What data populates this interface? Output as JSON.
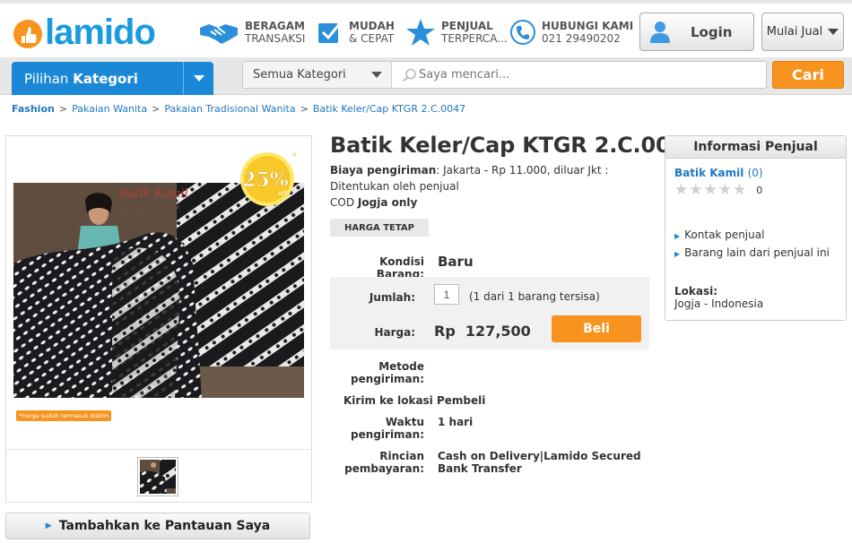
{
  "header": {
    "logo_text": "lamido",
    "features": [
      {
        "icon": "handshake-icon",
        "line1": "BERAGAM",
        "line2": "TRANSAKSI"
      },
      {
        "icon": "checkbox-icon",
        "line1": "MUDAH",
        "line2": "& CEPAT"
      },
      {
        "icon": "star-icon",
        "line1": "PENJUAL",
        "line2": "TERPERCA..."
      },
      {
        "icon": "phone-icon",
        "line1": "HUBUNGI KAMI",
        "line2": "021 29490202"
      }
    ],
    "login_label": "Login",
    "mulai_jual_label": "Mulai Jual"
  },
  "navbar": {
    "kategori_prefix": "Pilihan",
    "kategori_bold": "Kategori",
    "category_select": "Semua Kategori",
    "search_placeholder": "Saya mencari...",
    "search_button": "Cari"
  },
  "breadcrumb": [
    "Fashion",
    "Pakaian Wanita",
    "Pakaian Tradisional Wanita",
    "Batik Keler/Cap KTGR 2.C.0047"
  ],
  "gallery": {
    "image_text": "Batik Kamil",
    "image_subtext": "Jogjakarta - Indonesia",
    "discount_badge": "25%",
    "discount_off": "off",
    "discount_note": "*Harga sudah termasuk diskon",
    "watch_button": "Tambahkan ke Pantauan Saya"
  },
  "product": {
    "title": "Batik Keler/Cap KTGR 2.C.0047",
    "shipping_label": "Biaya pengiriman",
    "shipping_text": ": Jakarta - Rp 11.000, diluar Jkt : Ditentukan oleh penjual",
    "cod_label": "COD",
    "cod_value": "Jogja only",
    "price_type": "HARGA TETAP",
    "condition_label": "Kondisi Barang:",
    "condition_value": "Baru",
    "qty_label": "Jumlah:",
    "qty_value": "1",
    "stock_text": "(1 dari 1 barang tersisa)",
    "price_label": "Harga:",
    "price_value": "Rp  127,500",
    "buy_button": "Beli",
    "ship_method_label": "Metode pengiriman:",
    "ship_method_value": "Kirim ke lokasi Pembeli",
    "ship_time_label": "Waktu pengiriman:",
    "ship_time_value": "1 hari",
    "payment_label": "Rincian pembayaran:",
    "payment_line1": "Cash on Delivery|Lamido Secured",
    "payment_line2": "Bank Transfer"
  },
  "seller": {
    "heading": "Informasi Penjual",
    "name": "Batik Kamil",
    "rating_count": "0",
    "rating_value": "0",
    "links": [
      "Kontak penjual",
      "Barang lain dari penjual ini"
    ],
    "location_label": "Lokasi:",
    "location_value": "Jogja - Indonesia"
  },
  "colors": {
    "brand_blue": "#1a88d6",
    "accent_orange": "#f7931e",
    "link_blue": "#1f77c4"
  }
}
